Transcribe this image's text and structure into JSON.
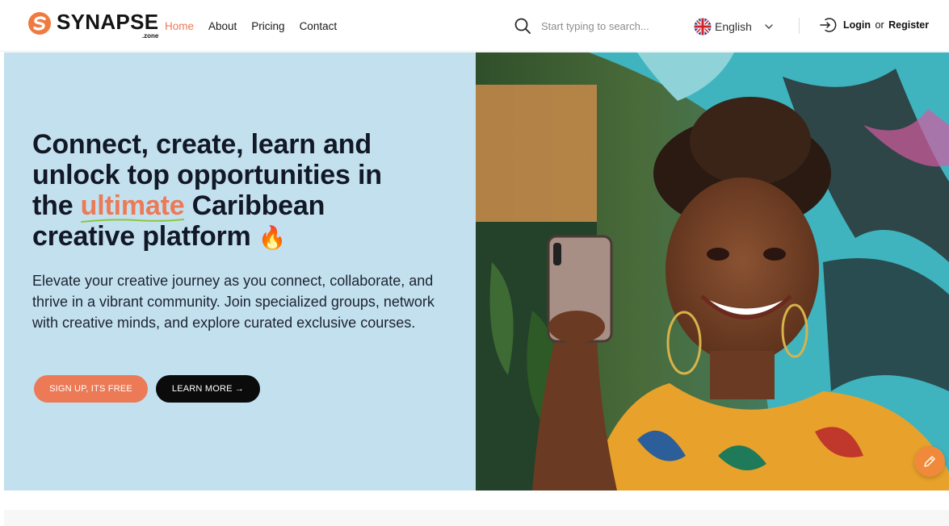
{
  "header": {
    "brand_name": "SYNAPSE",
    "brand_sub": ".zone",
    "nav": [
      {
        "label": "Home",
        "active": true
      },
      {
        "label": "About",
        "active": false
      },
      {
        "label": "Pricing",
        "active": false
      },
      {
        "label": "Contact",
        "active": false
      }
    ],
    "search_placeholder": "Start typing to search...",
    "language": "English",
    "login_label": "Login",
    "or_label": "or",
    "register_label": "Register"
  },
  "hero": {
    "headline_part1": "Connect, create, learn and unlock top opportunities in the ",
    "headline_accent": "ultimate",
    "headline_part2": " Caribbean creative platform",
    "headline_emoji": "🔥",
    "subtext": "Elevate your creative journey as you connect, collaborate, and thrive in a vibrant community. Join specialized groups, network with creative minds, and explore curated exclusive courses.",
    "signup_label": "SIGN UP, ITS FREE",
    "learn_more_label": "LEARN MORE →"
  },
  "colors": {
    "accent": "#ec7a56",
    "hero_bg": "#c3e0ef",
    "dark_button": "#0b0b0b",
    "fab": "#f08a3a"
  },
  "icons": [
    "synapse-logo-icon",
    "search-icon",
    "uk-flag-icon",
    "chevron-down-icon",
    "login-icon",
    "edit-pen-icon",
    "fire-emoji-icon"
  ]
}
